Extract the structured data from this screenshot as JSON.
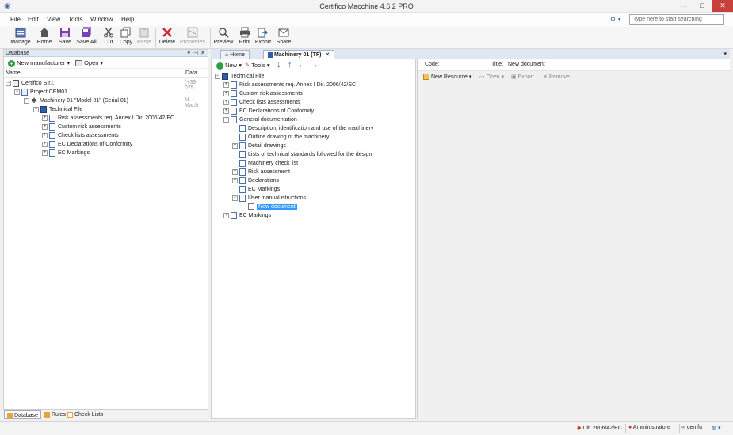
{
  "window": {
    "title": "Certifico Macchine 4.6.2 PRO",
    "minimize_glyph": "—",
    "maximize_glyph": "□",
    "close_glyph": "✕"
  },
  "menu": {
    "items": [
      "File",
      "Edit",
      "View",
      "Tools",
      "Window",
      "Help"
    ],
    "search_icon_glyph": "⚲",
    "search_dropdown_glyph": "▾",
    "search_placeholder": "Type here to start searching"
  },
  "toolbar": {
    "buttons": [
      {
        "label": "Manage",
        "icon": "manage-icon",
        "enabled": true
      },
      {
        "label": "Home",
        "icon": "home-icon",
        "enabled": true
      },
      {
        "label": "Save",
        "icon": "save-icon",
        "enabled": true
      },
      {
        "label": "Save All",
        "icon": "save-all-icon",
        "enabled": true
      },
      {
        "label": "Cut",
        "icon": "cut-icon",
        "enabled": true
      },
      {
        "label": "Copy",
        "icon": "copy-icon",
        "enabled": true
      },
      {
        "label": "Paste",
        "icon": "paste-icon",
        "enabled": false
      },
      {
        "label": "Delete",
        "icon": "delete-icon",
        "enabled": true
      },
      {
        "label": "Properties",
        "icon": "properties-icon",
        "enabled": false
      },
      {
        "label": "Preview",
        "icon": "preview-icon",
        "enabled": true
      },
      {
        "label": "Print",
        "icon": "print-icon",
        "enabled": true
      },
      {
        "label": "Export",
        "icon": "export-icon",
        "enabled": true
      },
      {
        "label": "Share",
        "icon": "share-icon",
        "enabled": true
      }
    ]
  },
  "left_panel": {
    "title": "Database",
    "header_controls": [
      "▾",
      "⊣",
      "✕"
    ],
    "new_manufacturer": "New manufacturer",
    "open": "Open",
    "col_name": "Name",
    "col_data": "Data",
    "tree": [
      {
        "label": "Certifico S.r.l.",
        "data": "(+39 075..."
      },
      {
        "label": "Project CEM01",
        "data": ""
      },
      {
        "label": "Machinery 01 \"Model 01\" (Serial 01)",
        "data": "M. - Mach"
      },
      {
        "label": "Technical File",
        "data": ""
      },
      {
        "label": "Risk assessments req. Annex I Dir. 2006/42/EC",
        "data": ""
      },
      {
        "label": "Custom risk assessments",
        "data": ""
      },
      {
        "label": "Check lists assessments",
        "data": ""
      },
      {
        "label": "EC Declarations of Conformity",
        "data": ""
      },
      {
        "label": "EC Markings",
        "data": ""
      }
    ],
    "footer_tabs": [
      "Database",
      "Rules",
      "Check Lists"
    ]
  },
  "tabs": {
    "home": "Home",
    "machinery": "Machinery 01 (TF)",
    "close_glyph": "✕",
    "dropdown_glyph": "▾"
  },
  "center_panel": {
    "new": "New",
    "tools": "Tools",
    "arrows": [
      "↓",
      "↑",
      "←",
      "→"
    ],
    "tree": [
      {
        "label": "Technical File"
      },
      {
        "label": "Risk assessments req. Annex I Dir. 2006/42/EC"
      },
      {
        "label": "Custom risk assessments"
      },
      {
        "label": "Check lists assessments"
      },
      {
        "label": "EC Declarations of Conformity"
      },
      {
        "label": "General documentation"
      },
      {
        "label": "Description, identification and use of the machinery"
      },
      {
        "label": "Outline drawing of the machinery"
      },
      {
        "label": "Detail drawings"
      },
      {
        "label": "Lists of technical standards followed for the design"
      },
      {
        "label": "Machinery check list"
      },
      {
        "label": "Risk assessment"
      },
      {
        "label": "Declarations"
      },
      {
        "label": "EC Markings"
      },
      {
        "label": "User manual istructions"
      },
      {
        "label": "New document"
      },
      {
        "label": "EC Markings"
      }
    ]
  },
  "right_panel": {
    "code_label": "Code:",
    "title_label": "Title:",
    "title_value": "New document",
    "new_resource": "New Resource",
    "open": "Open",
    "export": "Export",
    "remove": "Remove"
  },
  "statusbar": {
    "directive": "Dir. 2006/42/EC",
    "user": "Amministratore",
    "connection": "cemfu",
    "globe_glyph": "◍ ▾"
  }
}
